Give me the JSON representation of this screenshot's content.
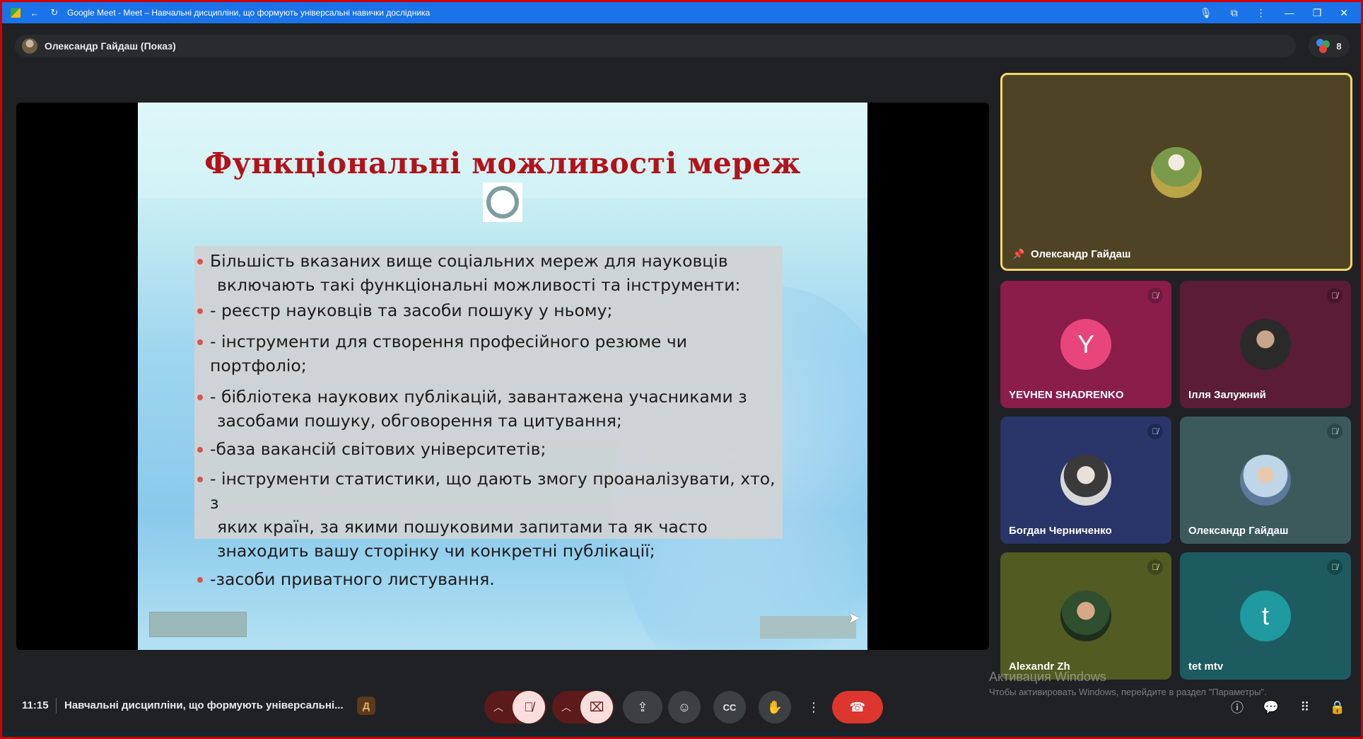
{
  "browser": {
    "title": "Google Meet - Meet – Навчальні дисципліни, що формують універсальні навички дослідника"
  },
  "presenter_bar": {
    "label": "Олександр Гайдаш (Показ)",
    "participant_count": "8"
  },
  "slide": {
    "title": "Функціональні можливості мереж",
    "bullets": [
      {
        "l1": "Більшість вказаних вище соціальних мереж для науковців",
        "l2": "включають такі функціональні можливості та інструменти:",
        "l3": ""
      },
      {
        "l1": "- реєстр науковців та засоби пошуку у ньому;",
        "l2": "",
        "l3": ""
      },
      {
        "l1": "- інструменти для створення професійного резюме чи портфоліо;",
        "l2": "",
        "l3": ""
      },
      {
        "l1": "- бібліотека наукових публікацій, завантажена учасниками з",
        "l2": "засобами пошуку, обговорення та цитування;",
        "l3": ""
      },
      {
        "l1": "-база вакансій світових університетів;",
        "l2": "",
        "l3": ""
      },
      {
        "l1": "- інструменти статистики, що дають змогу проаналізувати, хто, з",
        "l2": "яких країн, за якими пошуковими запитами та як часто",
        "l3": "знаходить вашу сторінку чи конкретні публікації;"
      },
      {
        "l1": "-засоби приватного листування.",
        "l2": "",
        "l3": ""
      }
    ]
  },
  "participants": {
    "main": {
      "name": "Олександр Гайдаш"
    },
    "tiles": [
      {
        "name": "YEVHEN SHADRENKO",
        "initial": "Y"
      },
      {
        "name": "Ілля Залужний"
      },
      {
        "name": "Богдан Черниченко"
      },
      {
        "name": "Олександр Гайдаш"
      },
      {
        "name": "Alexandr Zh"
      },
      {
        "name": "tet mtv",
        "initial": "t"
      }
    ]
  },
  "watermark": {
    "title": "Активация Windows",
    "subtitle": "Чтобы активировать Windows, перейдите в раздел \"Параметры\"."
  },
  "bottom_bar": {
    "time": "11:15",
    "meeting_title": "Навчальні дисципліни, що формують універсальні...",
    "doc_letter": "Д"
  },
  "colors": {
    "end_call": "#dc362e",
    "slide_title": "#b3121b",
    "active_speaker_border": "#f3d66a"
  },
  "icons": [
    "back-arrow-icon",
    "reload-icon",
    "microphone-icon",
    "extensions-icon",
    "kebab-menu-icon",
    "minimize-icon",
    "restore-icon",
    "close-icon",
    "pin-icon",
    "mic-off-icon",
    "camera-off-icon",
    "present-icon",
    "emoji-icon",
    "captions-icon",
    "raise-hand-icon",
    "more-options-icon",
    "end-call-icon",
    "info-icon",
    "chat-icon",
    "activities-icon",
    "host-controls-icon"
  ]
}
